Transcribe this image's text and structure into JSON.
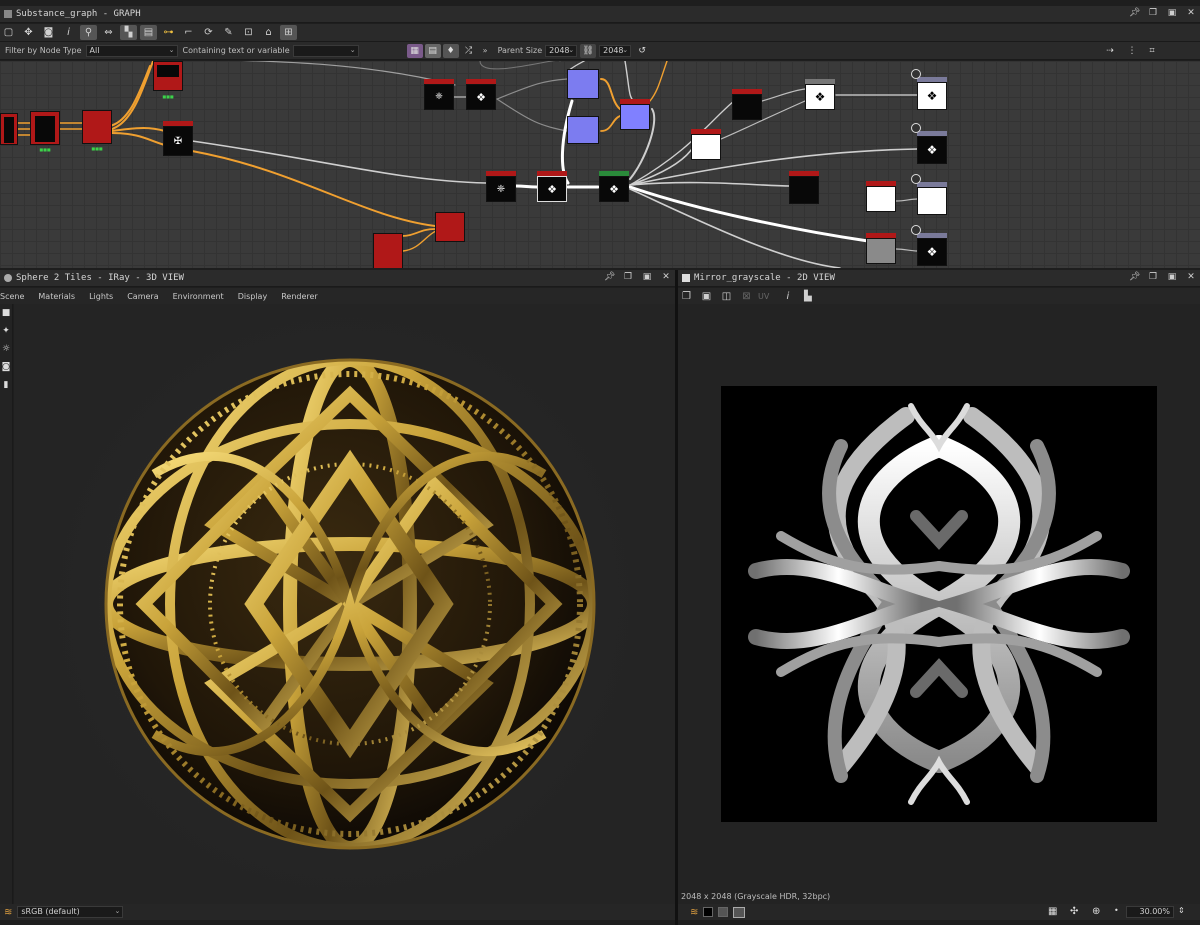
{
  "graph_panel": {
    "title": "Substance_graph - GRAPH",
    "filter_label": "Filter by Node Type",
    "filter_value": "All",
    "containing_label": "Containing text or variable",
    "containing_value": "",
    "parent_size_label": "Parent Size",
    "parent_size_w": "2048",
    "parent_size_h": "2048"
  },
  "view3d_panel": {
    "title": "Sphere 2 Tiles - IRay - 3D VIEW",
    "menu": [
      "Scene",
      "Materials",
      "Lights",
      "Camera",
      "Environment",
      "Display",
      "Renderer"
    ],
    "colorspace": "sRGB (default)"
  },
  "view2d_panel": {
    "title": "Mirror_grayscale - 2D VIEW",
    "uv_label": "UV",
    "info": "2048 x 2048 (Grayscale HDR, 32bpc)",
    "zoom": "30.00%"
  },
  "colors": {
    "accent_orange": "#f0a030",
    "node_red": "#b01818",
    "node_blue": "#8080ff",
    "wire_white": "#e8e8e8",
    "gold": "#c9a33a"
  }
}
